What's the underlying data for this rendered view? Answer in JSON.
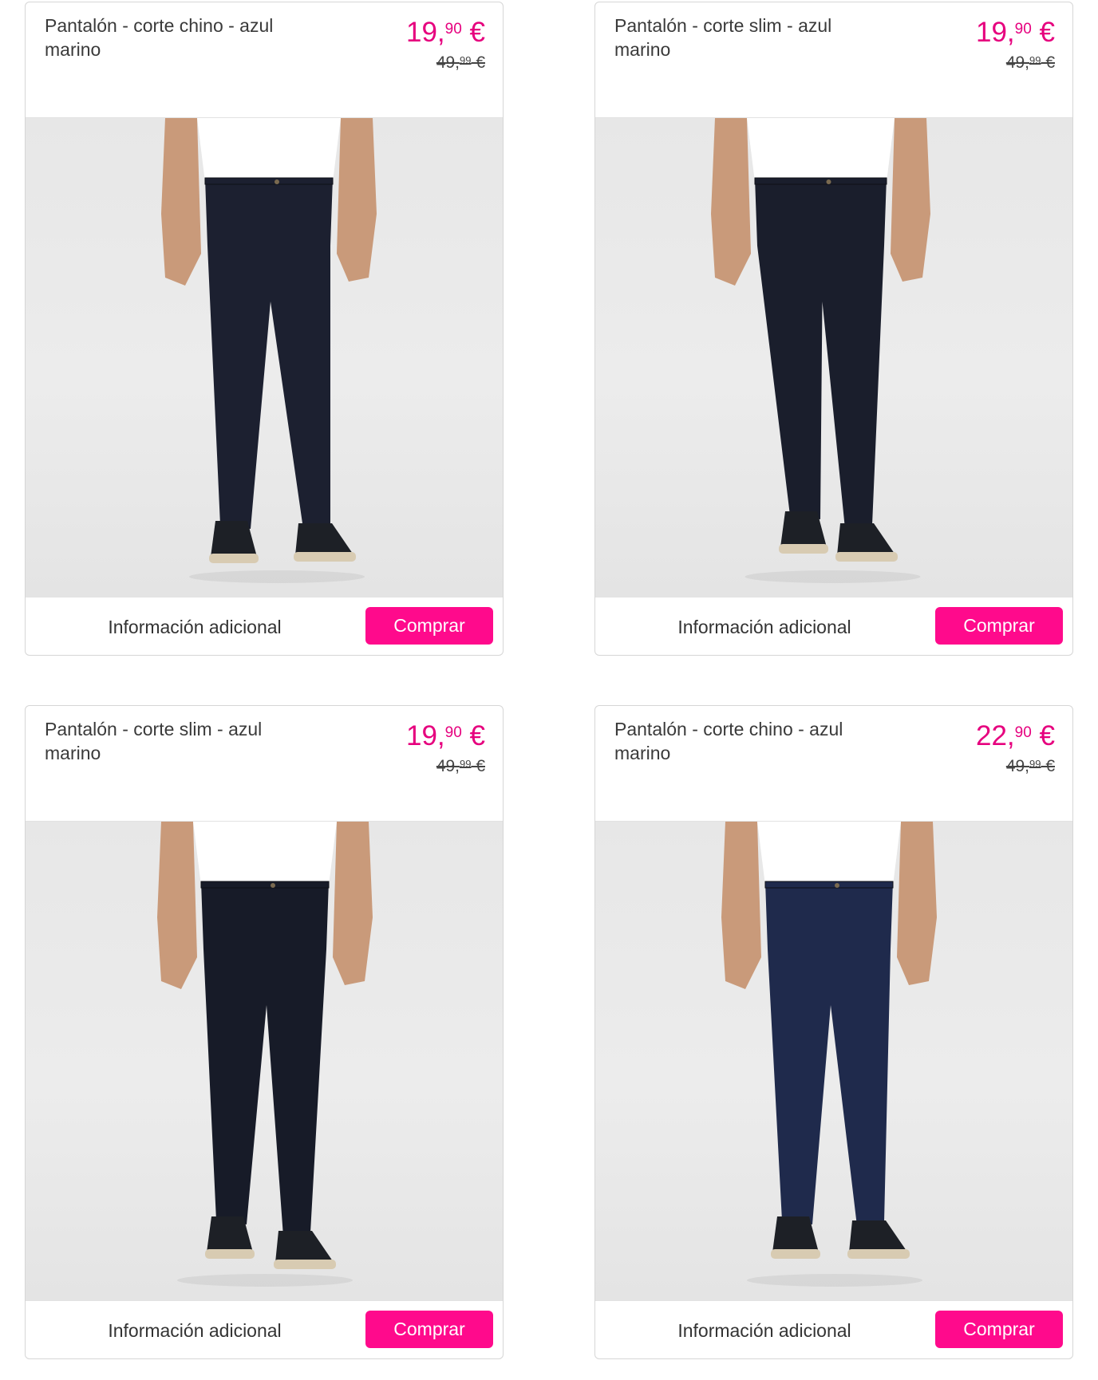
{
  "products": [
    {
      "title": "Pantalón - corte chino - azul marino",
      "price_int": "19,",
      "price_cents": "90",
      "price_currency": " €",
      "old_price_int": "49,",
      "old_price_cents": "99",
      "old_price_currency": " €",
      "info_label": "Información adicional",
      "buy_label": "Comprar",
      "pants_color": "#1c2030"
    },
    {
      "title": "Pantalón - corte slim - azul marino",
      "price_int": "19,",
      "price_cents": "90",
      "price_currency": " €",
      "old_price_int": "49,",
      "old_price_cents": "99",
      "old_price_currency": " €",
      "info_label": "Información adicional",
      "buy_label": "Comprar",
      "pants_color": "#1a1e2c"
    },
    {
      "title": "Pantalón - corte slim - azul marino",
      "price_int": "19,",
      "price_cents": "90",
      "price_currency": " €",
      "old_price_int": "49,",
      "old_price_cents": "99",
      "old_price_currency": " €",
      "info_label": "Información adicional",
      "buy_label": "Comprar",
      "pants_color": "#171b28"
    },
    {
      "title": "Pantalón - corte chino - azul marino",
      "price_int": "22,",
      "price_cents": "90",
      "price_currency": " €",
      "old_price_int": "49,",
      "old_price_cents": "99",
      "old_price_currency": " €",
      "info_label": "Información adicional",
      "buy_label": "Comprar",
      "pants_color": "#1f2a4c"
    }
  ],
  "colors": {
    "price": "#e6007e",
    "button": "#ff0a8c",
    "skin": "#c99a7a",
    "shirt": "#ffffff",
    "shoe": "#1d2026",
    "sole": "#d8cbb2"
  }
}
